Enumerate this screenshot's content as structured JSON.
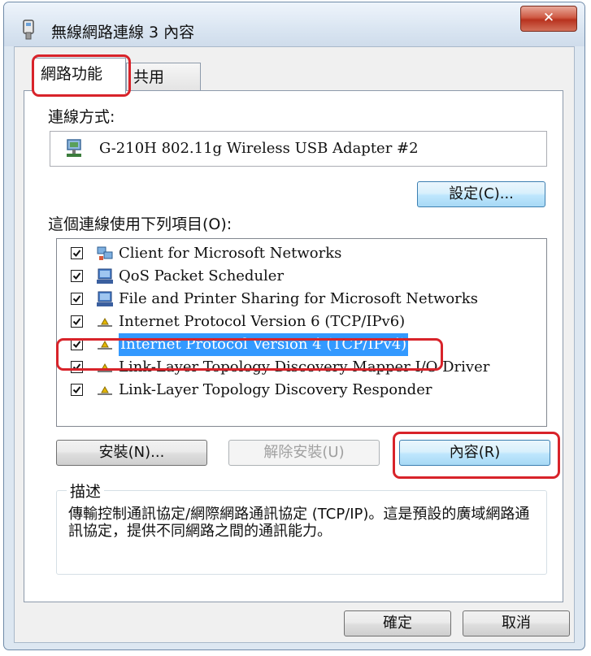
{
  "window": {
    "title": "無線網路連線 3 內容",
    "close_glyph": "✕"
  },
  "tabs": [
    {
      "label": "網路功能"
    },
    {
      "label": "共用"
    }
  ],
  "connect_using": {
    "label": "連線方式:",
    "adapter_name": "G-210H 802.11g Wireless USB Adapter #2",
    "configure_button": "設定(C)..."
  },
  "items_label": "這個連線使用下列項目(O):",
  "items": [
    {
      "label": "Client for Microsoft Networks",
      "checked": true,
      "icon": "network-client-icon"
    },
    {
      "label": "QoS Packet Scheduler",
      "checked": true,
      "icon": "network-service-icon"
    },
    {
      "label": "File and Printer Sharing for Microsoft Networks",
      "checked": true,
      "icon": "network-service-icon"
    },
    {
      "label": "Internet Protocol Version 6 (TCP/IPv6)",
      "checked": true,
      "icon": "protocol-icon"
    },
    {
      "label": "Internet Protocol Version 4 (TCP/IPv4)",
      "checked": true,
      "icon": "protocol-icon",
      "selected": true
    },
    {
      "label": "Link-Layer Topology Discovery Mapper I/O Driver",
      "checked": true,
      "icon": "protocol-icon"
    },
    {
      "label": "Link-Layer Topology Discovery Responder",
      "checked": true,
      "icon": "protocol-icon"
    }
  ],
  "actions": {
    "install": "安裝(N)...",
    "uninstall": "解除安裝(U)",
    "properties": "內容(R)"
  },
  "description": {
    "title": "描述",
    "text": "傳輸控制通訊協定/網際網路通訊協定 (TCP/IP)。這是預設的廣域網路通訊協定，提供不同網路之間的通訊能力。"
  },
  "footer": {
    "ok": "確定",
    "cancel": "取消"
  },
  "colors": {
    "highlight_annotation": "#d8232a",
    "selection": "#3399ff"
  }
}
